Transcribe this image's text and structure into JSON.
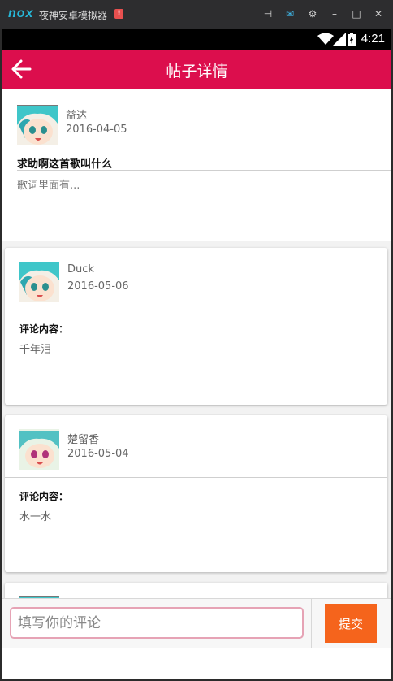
{
  "emulator": {
    "logo": "nox",
    "title": "夜神安卓模拟器",
    "alert": "!"
  },
  "statusbar": {
    "time": "4:21"
  },
  "appbar": {
    "title": "帖子详情",
    "back_icon": "arrow-left-icon"
  },
  "post": {
    "author": "益达",
    "date": "2016-04-05",
    "title": "求助啊这首歌叫什么",
    "body": "歌词里面有..."
  },
  "comments": [
    {
      "author": "Duck",
      "date": "2016-05-06",
      "label": "评论内容：",
      "text": "千年泪"
    },
    {
      "author": "楚留香",
      "date": "2016-05-04",
      "label": "评论内容：",
      "text": "水一水"
    }
  ],
  "composer": {
    "placeholder": "填写你的评论",
    "submit_label": "提交"
  },
  "colors": {
    "accent": "#dc0e4d",
    "submit": "#f5641c",
    "input_border": "#e6a3b5"
  }
}
